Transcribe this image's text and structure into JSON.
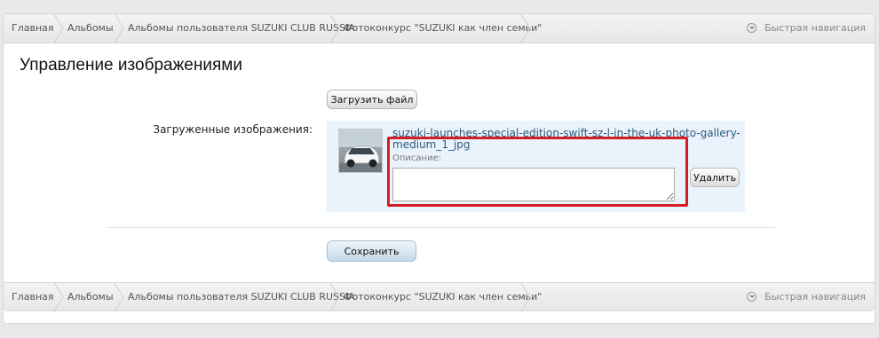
{
  "breadcrumb": {
    "items": [
      {
        "label": "Главная"
      },
      {
        "label": "Альбомы"
      },
      {
        "label": "Альбомы пользователя SUZUKI CLUB RUSSIA"
      },
      {
        "label": "Фотоконкурс \"SUZUKI как член семьи\""
      }
    ],
    "quick_nav": "Быстрая навигация"
  },
  "page_title": "Управление изображениями",
  "upload_button": "Загрузить файл",
  "uploaded_label": "Загруженные изображения:",
  "image": {
    "filename": "suzuki-launches-special-edition-swift-sz-l-in-the-uk-photo-gallery-medium_1_jpg",
    "description_label": "Описание:",
    "description_value": "",
    "delete_button": "Удалить"
  },
  "save_button": "Сохранить",
  "colors": {
    "link": "#2a5b7e",
    "highlight": "#d41e24",
    "upload_box_bg": "#eaf2fb"
  }
}
